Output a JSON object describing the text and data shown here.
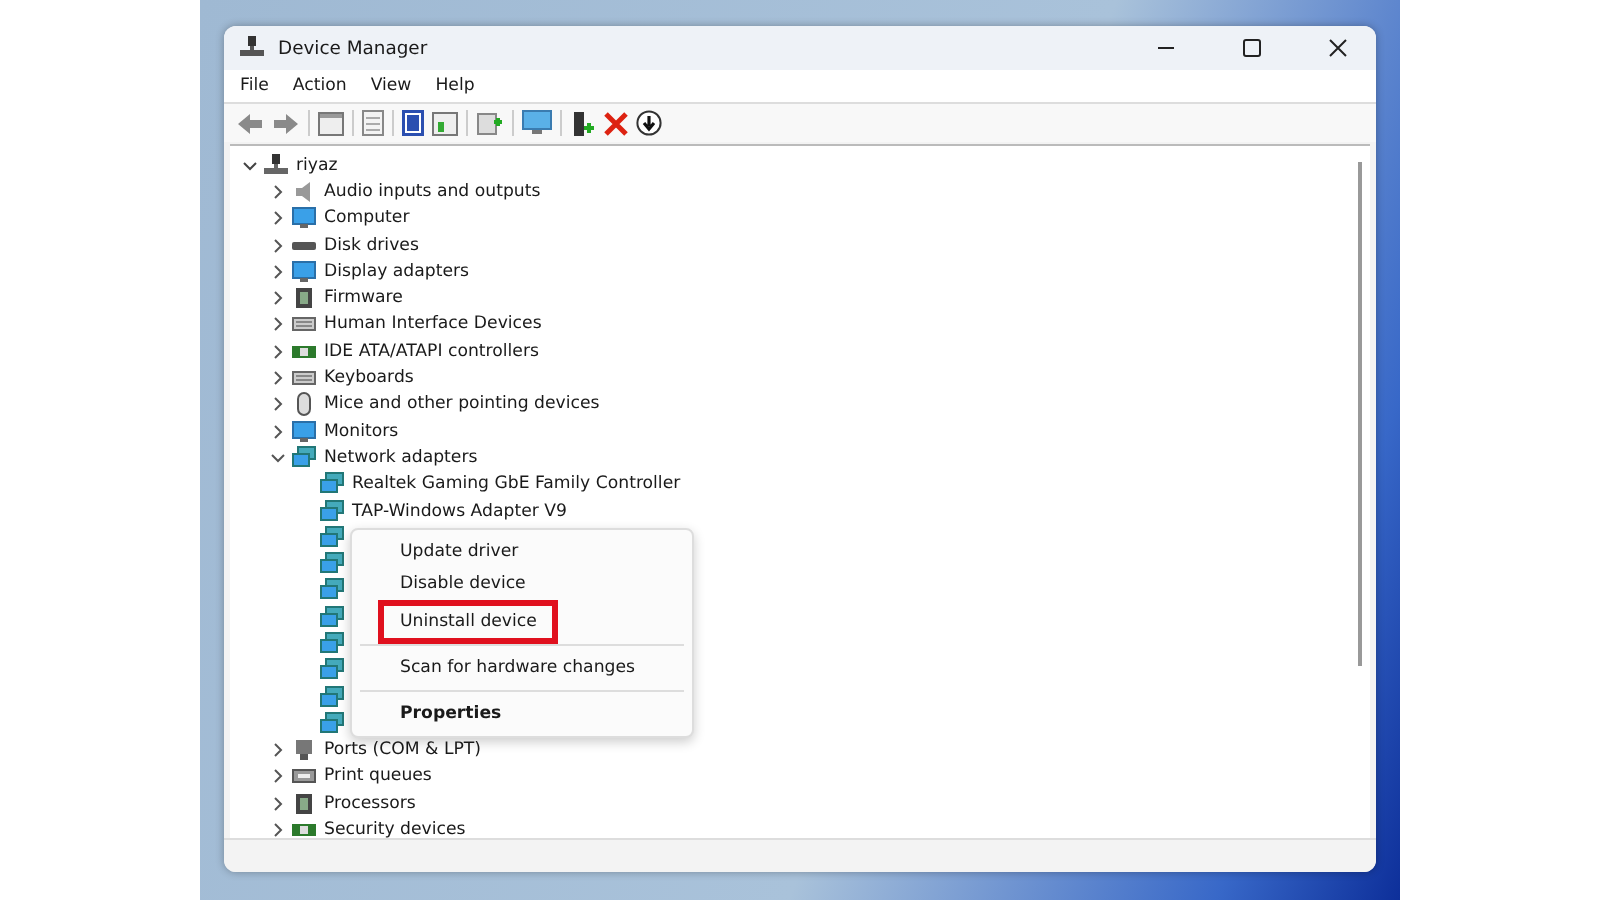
{
  "window": {
    "title": "Device Manager"
  },
  "menu_bar": [
    "File",
    "Action",
    "View",
    "Help"
  ],
  "tree": {
    "label": "riyaz",
    "expanded": true,
    "children": [
      {
        "label": "Audio inputs and outputs",
        "expanded": false,
        "kind": "speaker"
      },
      {
        "label": "Computer",
        "expanded": false,
        "kind": "monitor"
      },
      {
        "label": "Disk drives",
        "expanded": false,
        "kind": "disk"
      },
      {
        "label": "Display adapters",
        "expanded": false,
        "kind": "monitor"
      },
      {
        "label": "Firmware",
        "expanded": false,
        "kind": "chip"
      },
      {
        "label": "Human Interface Devices",
        "expanded": false,
        "kind": "keyboard"
      },
      {
        "label": "IDE ATA/ATAPI controllers",
        "expanded": false,
        "kind": "card"
      },
      {
        "label": "Keyboards",
        "expanded": false,
        "kind": "keyboard"
      },
      {
        "label": "Mice and other pointing devices",
        "expanded": false,
        "kind": "mouse"
      },
      {
        "label": "Monitors",
        "expanded": false,
        "kind": "monitor"
      },
      {
        "label": "Network adapters",
        "expanded": true,
        "kind": "network",
        "children": [
          {
            "kind": "labeled",
            "label": "Realtek Gaming GbE Family Controller"
          },
          {
            "kind": "labeled",
            "label": "TAP-Windows Adapter V9"
          },
          {
            "kind": "covered"
          },
          {
            "kind": "covered"
          },
          {
            "kind": "covered"
          },
          {
            "kind": "covered"
          },
          {
            "kind": "covered"
          },
          {
            "kind": "covered"
          },
          {
            "kind": "covered"
          },
          {
            "kind": "covered"
          }
        ]
      },
      {
        "label": "Ports (COM & LPT)",
        "expanded": false,
        "kind": "port"
      },
      {
        "label": "Print queues",
        "expanded": false,
        "kind": "printer"
      },
      {
        "label": "Processors",
        "expanded": false,
        "kind": "chip"
      },
      {
        "label": "Security devices",
        "expanded": false,
        "kind": "card"
      }
    ]
  },
  "context_menu": [
    {
      "kind": "item",
      "label": "Update driver",
      "highlighted": false,
      "default": false
    },
    {
      "kind": "item",
      "label": "Disable device",
      "highlighted": false,
      "default": false
    },
    {
      "kind": "item",
      "label": "Uninstall device",
      "highlighted": true,
      "default": false
    },
    {
      "kind": "separator"
    },
    {
      "kind": "item",
      "label": "Scan for hardware changes",
      "highlighted": false,
      "default": false
    },
    {
      "kind": "separator"
    },
    {
      "kind": "item",
      "label": "Properties",
      "highlighted": false,
      "default": true
    }
  ]
}
